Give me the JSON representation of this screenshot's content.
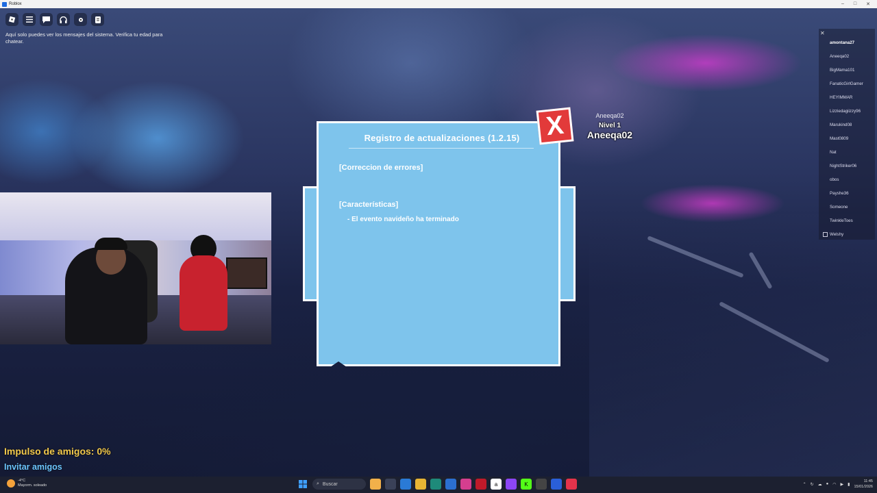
{
  "window": {
    "title": "Roblox",
    "controls": [
      "–",
      "□",
      "✕"
    ]
  },
  "topbar": {
    "icons": [
      "roblox-logo-icon",
      "menu-icon",
      "chat-icon",
      "headphones-icon",
      "gear-icon",
      "backpack-icon"
    ]
  },
  "system_message": "Aquí solo puedes ver los mensajes del sistema. Verifica tu edad para chatear.",
  "update_log": {
    "title": "Registro de actualizaciones (1.2.15)",
    "sections": [
      {
        "heading": "[Correccion de errores]",
        "items": []
      },
      {
        "heading": "[Características]",
        "items": [
          "- El evento navideño ha terminado"
        ]
      }
    ],
    "close_label": "X"
  },
  "overhead": {
    "username": "Aneeqa02",
    "level": "Nivel 1",
    "display": "Aneeqa02"
  },
  "player_list": {
    "close_label": "✕",
    "players": [
      "amontana27",
      "Aneeqa02",
      "BigMama101",
      "FanaticGirlGamer",
      "HEYIMMAR",
      "Lizziedagiizzy96",
      "Marukind08",
      "Mast0809",
      "Nat",
      "NightStriker06",
      "obos",
      "Payshe36",
      "Someone",
      "TwinkleToes",
      "Welshy"
    ]
  },
  "friends_boost": "Impulso de amigos: 0%",
  "invite_friends": "Invitar amigos",
  "taskbar": {
    "weather_temp": "-4°C",
    "weather_desc": "Mayorm. soleado",
    "search_placeholder": "Buscar",
    "time": "11:45",
    "date": "15/01/2026"
  }
}
